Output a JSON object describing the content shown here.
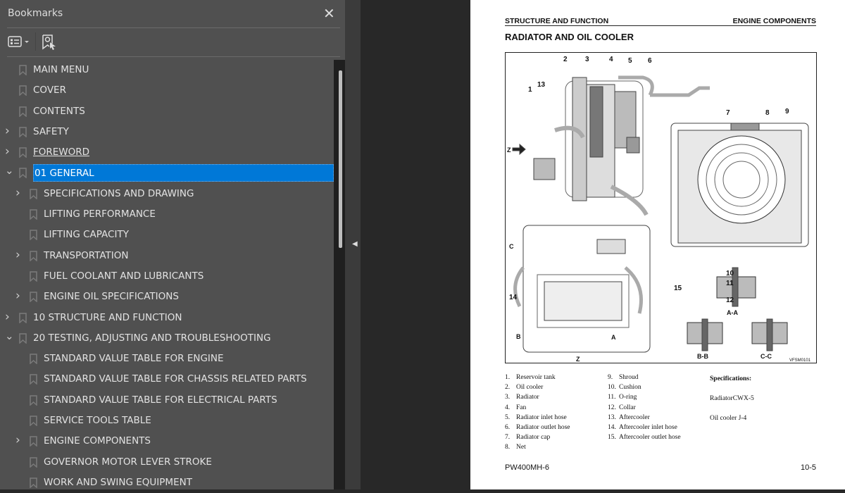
{
  "sidebar": {
    "title": "Bookmarks",
    "items": [
      {
        "label": "MAIN MENU",
        "level": 0,
        "expander": "none"
      },
      {
        "label": "COVER",
        "level": 0,
        "expander": "none"
      },
      {
        "label": "CONTENTS",
        "level": 0,
        "expander": "none"
      },
      {
        "label": "SAFETY",
        "level": 0,
        "expander": "collapsed"
      },
      {
        "label": "FOREWORD",
        "level": 0,
        "expander": "collapsed",
        "hover": true
      },
      {
        "label": "01 GENERAL",
        "level": 0,
        "expander": "expanded",
        "selected": true
      },
      {
        "label": "SPECIFICATIONS AND DRAWING",
        "level": 1,
        "expander": "collapsed"
      },
      {
        "label": "LIFTING PERFORMANCE",
        "level": 1,
        "expander": "none"
      },
      {
        "label": "LIFTING CAPACITY",
        "level": 1,
        "expander": "none"
      },
      {
        "label": "TRANSPORTATION",
        "level": 1,
        "expander": "collapsed"
      },
      {
        "label": "FUEL COOLANT AND LUBRICANTS",
        "level": 1,
        "expander": "none"
      },
      {
        "label": "ENGINE OIL SPECIFICATIONS",
        "level": 1,
        "expander": "collapsed"
      },
      {
        "label": "10 STRUCTURE AND FUNCTION",
        "level": 0,
        "expander": "collapsed"
      },
      {
        "label": "20 TESTING, ADJUSTING AND TROUBLESHOOTING",
        "level": 0,
        "expander": "expanded"
      },
      {
        "label": "STANDARD VALUE TABLE FOR ENGINE",
        "level": 1,
        "expander": "none"
      },
      {
        "label": "STANDARD VALUE TABLE FOR CHASSIS RELATED PARTS",
        "level": 1,
        "expander": "none"
      },
      {
        "label": "STANDARD VALUE TABLE FOR ELECTRICAL PARTS",
        "level": 1,
        "expander": "none"
      },
      {
        "label": "SERVICE TOOLS TABLE",
        "level": 1,
        "expander": "none"
      },
      {
        "label": "ENGINE COMPONENTS",
        "level": 1,
        "expander": "collapsed"
      },
      {
        "label": "GOVERNOR MOTOR LEVER STROKE",
        "level": 1,
        "expander": "none"
      },
      {
        "label": "WORK AND SWING EQUIPMENT",
        "level": 1,
        "expander": "none"
      }
    ],
    "selected_color": "#0078d7"
  },
  "page": {
    "header_left": "STRUCTURE AND FUNCTION",
    "header_right": "ENGINE COMPONENTS",
    "title": "RADIATOR AND OIL COOLER",
    "figure": {
      "callouts": [
        "1",
        "2",
        "3",
        "4",
        "5",
        "6",
        "7",
        "8",
        "9",
        "10",
        "11",
        "12",
        "13",
        "14",
        "15"
      ],
      "view_labels": {
        "z_arrow": "Z",
        "z_bottom": "Z",
        "a": "A",
        "b": "B",
        "c": "C",
        "aa": "A-A",
        "bb": "B-B",
        "cc": "C-C"
      },
      "code": "VFSM0101"
    },
    "legend_col1": [
      {
        "n": "1.",
        "t": "Reservoir tank"
      },
      {
        "n": "2.",
        "t": "Oil cooler"
      },
      {
        "n": "3.",
        "t": "Radiator"
      },
      {
        "n": "4.",
        "t": "Fan"
      },
      {
        "n": "5.",
        "t": "Radiator inlet hose"
      },
      {
        "n": "6.",
        "t": "Radiator outlet hose"
      },
      {
        "n": "7.",
        "t": "Radiator cap"
      },
      {
        "n": "8.",
        "t": "Net"
      }
    ],
    "legend_col2": [
      {
        "n": "9.",
        "t": "Shroud"
      },
      {
        "n": "10.",
        "t": "Cushion"
      },
      {
        "n": "11.",
        "t": "O-ring"
      },
      {
        "n": "12.",
        "t": "Collar"
      },
      {
        "n": "13.",
        "t": "Aftercooler"
      },
      {
        "n": "14.",
        "t": "Aftercooler inlet hose"
      },
      {
        "n": "15.",
        "t": "Aftercooler outlet hose"
      }
    ],
    "specs": {
      "heading": "Specifications:",
      "radiator": "RadiatorCWX-5",
      "oil_cooler": "Oil cooler J-4"
    },
    "footer_left": "PW400MH-6",
    "footer_right": "10-5"
  }
}
